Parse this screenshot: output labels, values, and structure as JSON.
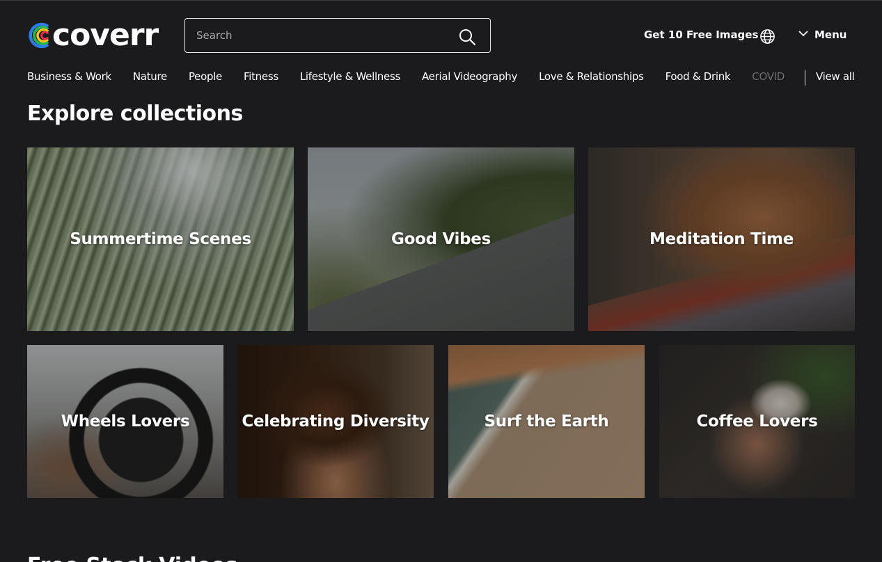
{
  "header": {
    "logo_text": "coverr",
    "search_placeholder": "Search",
    "search_value": "",
    "free_images_label": "Get 10 Free Images",
    "language_icon": "globe-icon",
    "menu_label": "Menu",
    "menu_icon": "chevron-down-icon"
  },
  "categories": {
    "items": [
      {
        "label": "Business & Work"
      },
      {
        "label": "Nature"
      },
      {
        "label": "People"
      },
      {
        "label": "Fitness"
      },
      {
        "label": "Lifestyle & Wellness"
      },
      {
        "label": "Aerial Videography"
      },
      {
        "label": "Love & Relationships"
      },
      {
        "label": "Food & Drink"
      },
      {
        "label": "COVID"
      }
    ],
    "view_all_label": "View all"
  },
  "collections": {
    "section_title": "Explore collections",
    "items": [
      {
        "title": "Summertime Scenes"
      },
      {
        "title": "Good Vibes"
      },
      {
        "title": "Meditation Time"
      },
      {
        "title": "Wheels Lovers"
      },
      {
        "title": "Celebrating Diversity"
      },
      {
        "title": "Surf the Earth"
      },
      {
        "title": "Coffee Lovers"
      }
    ]
  },
  "next_section": {
    "title": "Free Stock Videos"
  },
  "colors": {
    "background": "#1b1a1d",
    "text": "#ffffff",
    "muted_text": "#6b6a6e",
    "logo_stripes": [
      "#2f7be6",
      "#27b35a",
      "#f5c518",
      "#f0832a",
      "#e6304a"
    ]
  }
}
